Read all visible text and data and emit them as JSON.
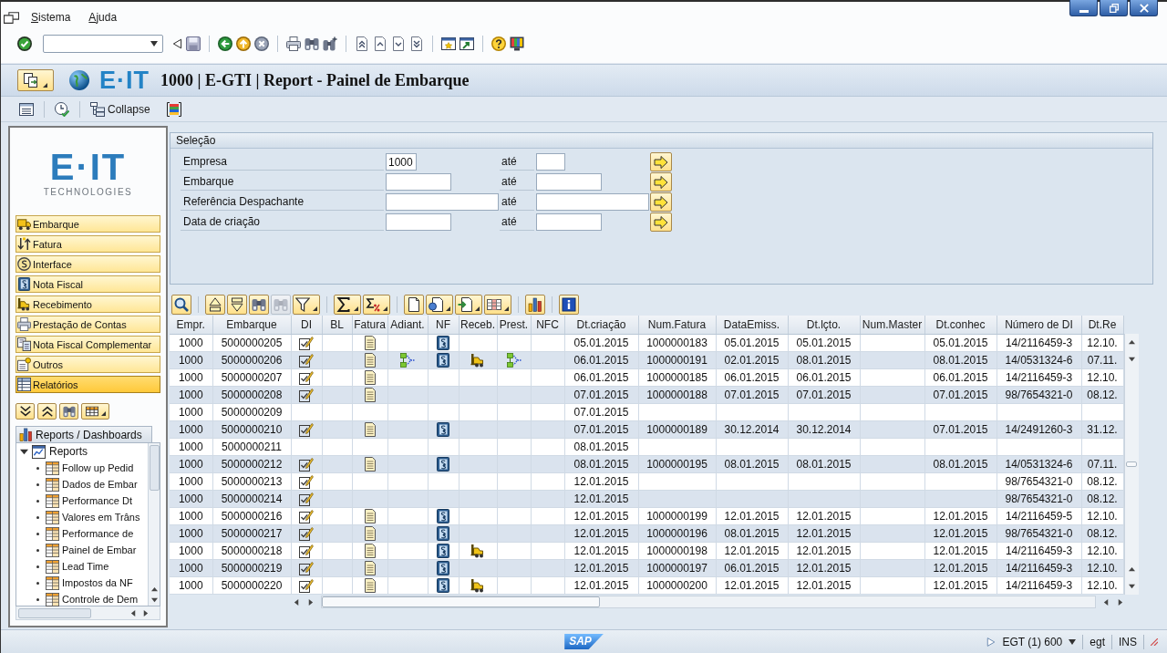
{
  "menu": [
    {
      "label": "Sistema"
    },
    {
      "label": "Ajuda"
    }
  ],
  "header": {
    "logo": "E·IT",
    "title": "1000 | E-GTI | Report - Painel de Embarque"
  },
  "app_toolbar": {
    "collapse": "Collapse"
  },
  "sidebar": {
    "logo": {
      "mark": "E·IT",
      "tagline": "TECHNOLOGIES"
    },
    "buttons": [
      {
        "label": "Embarque",
        "selected": false
      },
      {
        "label": "Fatura",
        "selected": false
      },
      {
        "label": "Interface",
        "selected": false
      },
      {
        "label": "Nota Fiscal",
        "selected": false
      },
      {
        "label": "Recebimento",
        "selected": false
      },
      {
        "label": "Prestação de Contas",
        "selected": false
      },
      {
        "label": "Nota Fiscal Complementar",
        "selected": false
      },
      {
        "label": "Outros",
        "selected": false
      },
      {
        "label": "Relatórios",
        "selected": true
      }
    ],
    "tab": "Reports / Dashboards",
    "tree": [
      {
        "label": "Reports",
        "expanded": true,
        "children": [
          {
            "label": "Follow up Pedid"
          },
          {
            "label": "Dados de Embar"
          },
          {
            "label": "Performance Dt"
          },
          {
            "label": "Valores em Trâns"
          },
          {
            "label": "Performance de"
          },
          {
            "label": "Painel de Embar"
          },
          {
            "label": "Lead Time"
          },
          {
            "label": "Impostos da NF"
          },
          {
            "label": "Controle de Dem"
          }
        ]
      }
    ]
  },
  "selection": {
    "title": "Seleção",
    "fields": [
      {
        "label": "Empresa",
        "low": "1000",
        "to": "até"
      },
      {
        "label": "Embarque",
        "to": "até"
      },
      {
        "label": "Referência Despachante",
        "to": "até"
      },
      {
        "label": "Data de criação",
        "to": "até"
      }
    ]
  },
  "table": {
    "toolbar": [
      [
        {
          "kind": "details",
          "disabled": false
        }
      ],
      [
        {
          "kind": "sort-ascending",
          "disabled": false
        },
        {
          "kind": "sort-descending",
          "disabled": false
        },
        {
          "kind": "find",
          "disabled": false
        },
        {
          "kind": "find-next",
          "disabled": true
        },
        {
          "kind": "filter",
          "disabled": false
        }
      ],
      [
        {
          "kind": "sum",
          "disabled": false
        },
        {
          "kind": "subtotals",
          "disabled": false
        }
      ],
      [
        {
          "kind": "print-preview",
          "disabled": false
        },
        {
          "kind": "views",
          "disabled": false
        },
        {
          "kind": "export",
          "disabled": false
        },
        {
          "kind": "layout",
          "disabled": false
        }
      ],
      [
        {
          "kind": "chart",
          "disabled": false
        }
      ],
      [
        {
          "kind": "info",
          "disabled": false
        }
      ]
    ],
    "columns": [
      "Empr.",
      "Embarque",
      "DI",
      "BL",
      "Fatura",
      "Adiant.",
      "NF",
      "Receb.",
      "Prest.",
      "NFC",
      "Dt.criação",
      "Num.Fatura",
      "DataEmiss.",
      "Dt.lçto.",
      "Num.Master",
      "Dt.conhec",
      "Número de DI",
      "Dt.Re"
    ],
    "rows": [
      {
        "empr": "1000",
        "embarque": "5000000205",
        "di": true,
        "fatura": true,
        "adiant": false,
        "nf": true,
        "receb": false,
        "prest": false,
        "dt_criacao": "05.01.2015",
        "num_fatura": "1000000183",
        "data_emiss": "05.01.2015",
        "dt_lcto": "05.01.2015",
        "dt_conhec": "05.01.2015",
        "numero_di": "14/2116459-3",
        "dt_re": "12.10."
      },
      {
        "empr": "1000",
        "embarque": "5000000206",
        "di": true,
        "fatura": true,
        "adiant": true,
        "nf": true,
        "receb": true,
        "prest": true,
        "dt_criacao": "06.01.2015",
        "num_fatura": "1000000191",
        "data_emiss": "02.01.2015",
        "dt_lcto": "08.01.2015",
        "dt_conhec": "08.01.2015",
        "numero_di": "14/0531324-6",
        "dt_re": "07.11."
      },
      {
        "empr": "1000",
        "embarque": "5000000207",
        "di": true,
        "fatura": true,
        "adiant": false,
        "nf": false,
        "receb": false,
        "prest": false,
        "dt_criacao": "06.01.2015",
        "num_fatura": "1000000185",
        "data_emiss": "06.01.2015",
        "dt_lcto": "06.01.2015",
        "dt_conhec": "06.01.2015",
        "numero_di": "14/2116459-3",
        "dt_re": "12.10."
      },
      {
        "empr": "1000",
        "embarque": "5000000208",
        "di": true,
        "fatura": true,
        "adiant": false,
        "nf": false,
        "receb": false,
        "prest": false,
        "dt_criacao": "07.01.2015",
        "num_fatura": "1000000188",
        "data_emiss": "07.01.2015",
        "dt_lcto": "07.01.2015",
        "dt_conhec": "07.01.2015",
        "numero_di": "98/7654321-0",
        "dt_re": "08.12."
      },
      {
        "empr": "1000",
        "embarque": "5000000209",
        "di": false,
        "fatura": false,
        "adiant": false,
        "nf": false,
        "receb": false,
        "prest": false,
        "dt_criacao": "07.01.2015"
      },
      {
        "empr": "1000",
        "embarque": "5000000210",
        "di": true,
        "fatura": true,
        "adiant": false,
        "nf": true,
        "receb": false,
        "prest": false,
        "dt_criacao": "07.01.2015",
        "num_fatura": "1000000189",
        "data_emiss": "30.12.2014",
        "dt_lcto": "30.12.2014",
        "dt_conhec": "07.01.2015",
        "numero_di": "14/2491260-3",
        "dt_re": "31.12."
      },
      {
        "empr": "1000",
        "embarque": "5000000211",
        "di": false,
        "fatura": false,
        "adiant": false,
        "nf": false,
        "receb": false,
        "prest": false,
        "dt_criacao": "08.01.2015"
      },
      {
        "empr": "1000",
        "embarque": "5000000212",
        "di": true,
        "fatura": true,
        "adiant": false,
        "nf": true,
        "receb": false,
        "prest": false,
        "dt_criacao": "08.01.2015",
        "num_fatura": "1000000195",
        "data_emiss": "08.01.2015",
        "dt_lcto": "08.01.2015",
        "dt_conhec": "08.01.2015",
        "numero_di": "14/0531324-6",
        "dt_re": "07.11."
      },
      {
        "empr": "1000",
        "embarque": "5000000213",
        "di": true,
        "fatura": false,
        "adiant": false,
        "nf": false,
        "receb": false,
        "prest": false,
        "dt_criacao": "12.01.2015",
        "numero_di": "98/7654321-0",
        "dt_re": "08.12."
      },
      {
        "empr": "1000",
        "embarque": "5000000214",
        "di": true,
        "fatura": false,
        "adiant": false,
        "nf": false,
        "receb": false,
        "prest": false,
        "dt_criacao": "12.01.2015",
        "numero_di": "98/7654321-0",
        "dt_re": "08.12."
      },
      {
        "empr": "1000",
        "embarque": "5000000216",
        "di": true,
        "fatura": true,
        "adiant": false,
        "nf": true,
        "receb": false,
        "prest": false,
        "dt_criacao": "12.01.2015",
        "num_fatura": "1000000199",
        "data_emiss": "12.01.2015",
        "dt_lcto": "12.01.2015",
        "dt_conhec": "12.01.2015",
        "numero_di": "14/2116459-5",
        "dt_re": "12.10."
      },
      {
        "empr": "1000",
        "embarque": "5000000217",
        "di": true,
        "fatura": true,
        "adiant": false,
        "nf": true,
        "receb": false,
        "prest": false,
        "dt_criacao": "12.01.2015",
        "num_fatura": "1000000196",
        "data_emiss": "08.01.2015",
        "dt_lcto": "12.01.2015",
        "dt_conhec": "12.01.2015",
        "numero_di": "98/7654321-0",
        "dt_re": "08.12."
      },
      {
        "empr": "1000",
        "embarque": "5000000218",
        "di": true,
        "fatura": true,
        "adiant": false,
        "nf": true,
        "receb": true,
        "prest": false,
        "dt_criacao": "12.01.2015",
        "num_fatura": "1000000198",
        "data_emiss": "12.01.2015",
        "dt_lcto": "12.01.2015",
        "dt_conhec": "12.01.2015",
        "numero_di": "14/2116459-3",
        "dt_re": "12.10."
      },
      {
        "empr": "1000",
        "embarque": "5000000219",
        "di": true,
        "fatura": true,
        "adiant": false,
        "nf": true,
        "receb": false,
        "prest": false,
        "dt_criacao": "12.01.2015",
        "num_fatura": "1000000197",
        "data_emiss": "06.01.2015",
        "dt_lcto": "12.01.2015",
        "dt_conhec": "12.01.2015",
        "numero_di": "14/2116459-3",
        "dt_re": "12.10."
      },
      {
        "empr": "1000",
        "embarque": "5000000220",
        "di": true,
        "fatura": true,
        "adiant": false,
        "nf": true,
        "receb": true,
        "prest": false,
        "dt_criacao": "12.01.2015",
        "num_fatura": "1000000200",
        "data_emiss": "12.01.2015",
        "dt_lcto": "12.01.2015",
        "dt_conhec": "12.01.2015",
        "numero_di": "14/2116459-3",
        "dt_re": "12.10."
      }
    ]
  },
  "status_bar": {
    "logo": "SAP",
    "system": "EGT (1) 600",
    "server": "egt",
    "mode": "INS"
  }
}
